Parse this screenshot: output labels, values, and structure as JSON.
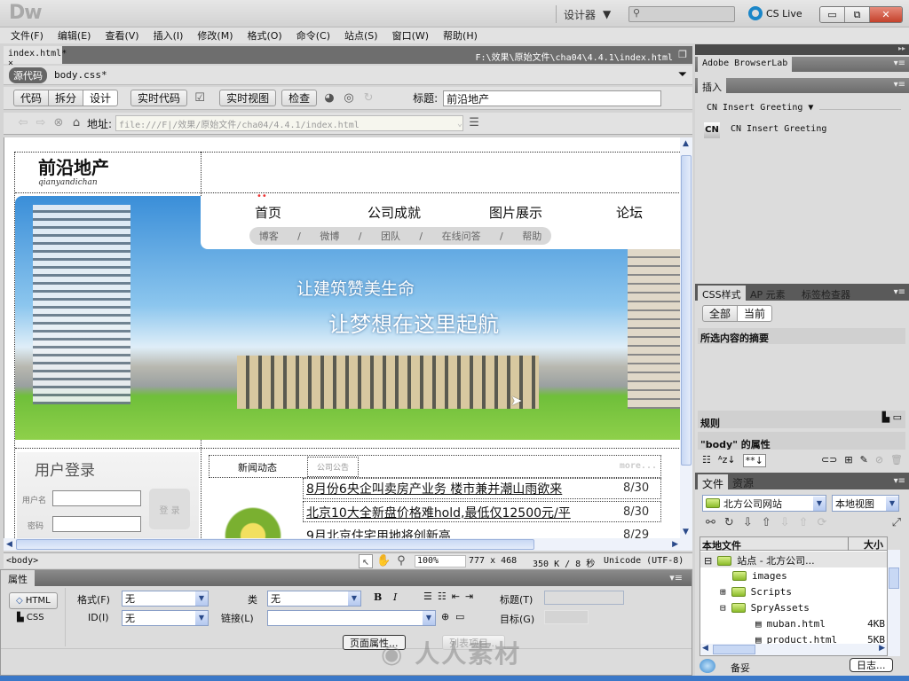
{
  "app": {
    "logo": "Dw",
    "workspace": "设计器",
    "search_placeholder": "",
    "cslive": "CS Live",
    "window_buttons": {
      "minimize": "▭",
      "restore": "⧉",
      "close": "✕"
    }
  },
  "menu": [
    "文件(F)",
    "编辑(E)",
    "查看(V)",
    "插入(I)",
    "修改(M)",
    "格式(O)",
    "命令(C)",
    "站点(S)",
    "窗口(W)",
    "帮助(H)"
  ],
  "document": {
    "tab": "index.html*",
    "tab_close": "×",
    "path": "F:\\效果\\原始文件\\cha04\\4.4.1\\index.html",
    "source_code": "源代码",
    "related_file": "body.css*"
  },
  "toolbar": {
    "code": "代码",
    "split": "拆分",
    "design": "设计",
    "live_code": "实时代码",
    "live_view": "实时视图",
    "inspect": "检查",
    "title_label": "标题:",
    "title_value": "前沿地产"
  },
  "nav": {
    "address_label": "地址:",
    "address_value": "file:///F|/效果/原始文件/cha04/4.4.1/index.html"
  },
  "page": {
    "brand": "前沿地产",
    "brand_pinyin": "qianyandichan",
    "main_nav": [
      "首页",
      "公司成就",
      "图片展示",
      "论坛"
    ],
    "sub_nav": [
      "博客",
      "微博",
      "团队",
      "在线问答",
      "帮助"
    ],
    "slogan1": "让建筑赞美生命",
    "slogan2": "让梦想在这里起航",
    "login": {
      "title": "用户登录",
      "username_label": "用户名",
      "password_label": "密码",
      "button": "登 录"
    },
    "news_tabs": [
      "新闻动态",
      "公司公告"
    ],
    "more": "more...",
    "news": [
      {
        "title": "8月份6央企叫卖房产业务 楼市兼并潮山雨欲来",
        "date": "8/30"
      },
      {
        "title": "北京10大全新盘价格难hold,最低仅12500元/平",
        "date": "8/30"
      },
      {
        "title": "9月北京住宅用地将创新高",
        "date": "8/29"
      }
    ]
  },
  "status": {
    "tag": "<body>",
    "zoom": "100%",
    "size": "777 x 468",
    "download": "350 K / 8 秒",
    "encoding": "Unicode (UTF-8)"
  },
  "properties": {
    "panel": "属性",
    "html": "HTML",
    "css": "CSS",
    "format_label": "格式(F)",
    "format_value": "无",
    "class_label": "类",
    "class_value": "无",
    "id_label": "ID(I)",
    "id_value": "无",
    "link_label": "链接(L)",
    "link_value": "",
    "title_label": "标题(T)",
    "target_label": "目标(G)",
    "bold": "B",
    "italic": "I",
    "page_props": "页面属性...",
    "list_item": "列表项目..."
  },
  "right_panel": {
    "browserlab": "Adobe BrowserLab",
    "insert": "插入",
    "insert_category": "CN Insert Greeting",
    "insert_item": "CN Insert Greeting",
    "insert_icon_text": "CN",
    "css_tabs": [
      "CSS样式",
      "AP 元素",
      "标签检查器"
    ],
    "css_all": "全部",
    "css_current": "当前",
    "summary": "所选内容的摘要",
    "rules": "规则",
    "body_props": "\"body\" 的属性",
    "files_tabs": [
      "文件",
      "资源"
    ],
    "site": "北方公司网站",
    "view": "本地视图",
    "col_local": "本地文件",
    "col_size": "大小",
    "tree": [
      {
        "name": "站点 - 北方公司...",
        "size": ""
      },
      {
        "name": "images",
        "size": ""
      },
      {
        "name": "Scripts",
        "size": ""
      },
      {
        "name": "SpryAssets",
        "size": ""
      },
      {
        "name": "muban.html",
        "size": "4KB"
      },
      {
        "name": "product.html",
        "size": "5KB"
      }
    ],
    "footer_label": "备妥",
    "log": "日志..."
  },
  "watermark": "人人素材"
}
